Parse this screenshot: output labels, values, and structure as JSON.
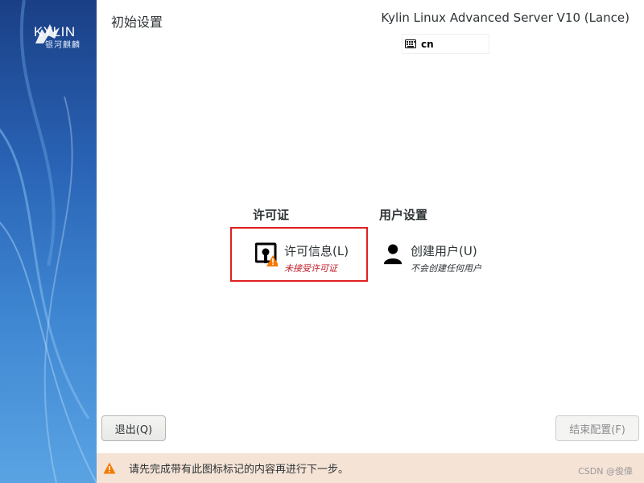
{
  "sidebar": {
    "logo_text": "KYLIN",
    "logo_sub": "银河麒麟"
  },
  "header": {
    "page_title": "初始设置",
    "product_title": "Kylin Linux Advanced Server V10 (Lance)",
    "keyboard_layout": "cn"
  },
  "sections": {
    "license": {
      "title": "许可证",
      "spoke_title": "许可信息(L)",
      "spoke_status": "未接受许可证",
      "status_color": "#c01c28"
    },
    "user": {
      "title": "用户设置",
      "spoke_title": "创建用户(U)",
      "spoke_status": "不会创建任何用户",
      "status_color": "#2e3436"
    }
  },
  "buttons": {
    "quit": "退出(Q)",
    "finish": "结束配置(F)"
  },
  "warning_bar": {
    "text": "请先完成带有此图标标记的内容再进行下一步。",
    "icon": "warning-icon",
    "color": "#f57900"
  },
  "watermark": "CSDN @俊偉"
}
